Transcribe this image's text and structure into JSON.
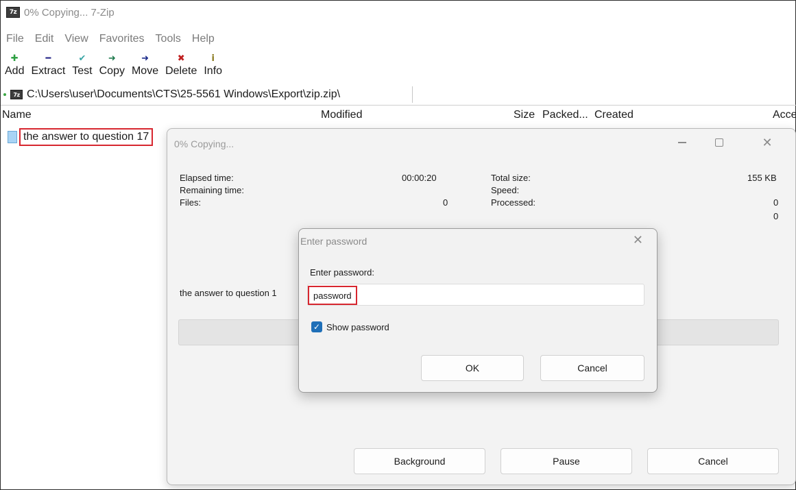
{
  "main_window": {
    "title": "0% Copying... 7-Zip",
    "app_icon_text": "7z"
  },
  "menu": [
    "File",
    "Edit",
    "View",
    "Favorites",
    "Tools",
    "Help"
  ],
  "toolbar": [
    {
      "label": "Add",
      "icon": "plus-icon",
      "glyph": "✚"
    },
    {
      "label": "Extract",
      "icon": "minus-icon",
      "glyph": "━"
    },
    {
      "label": "Test",
      "icon": "check-icon",
      "glyph": "✔"
    },
    {
      "label": "Copy",
      "icon": "arrow-right-icon",
      "glyph": "➜"
    },
    {
      "label": "Move",
      "icon": "arrow-right-icon",
      "glyph": "➜"
    },
    {
      "label": "Delete",
      "icon": "x-icon",
      "glyph": "✖"
    },
    {
      "label": "Info",
      "icon": "info-icon",
      "glyph": "i"
    }
  ],
  "address": {
    "path": "C:\\Users\\user\\Documents\\CTS\\25-5561 Windows\\Export\\zip.zip\\"
  },
  "columns": [
    "Name",
    "Modified",
    "Size",
    "Packed...",
    "Created",
    "Acce"
  ],
  "files": [
    {
      "name": "the answer to question 17"
    }
  ],
  "copy_dialog": {
    "title": "0% Copying...",
    "elapsed_label": "Elapsed time:",
    "elapsed_value": "00:00:20",
    "remaining_label": "Remaining time:",
    "files_label": "Files:",
    "files_value": "0",
    "total_size_label": "Total size:",
    "total_size_value": "155 KB",
    "speed_label": "Speed:",
    "processed_label": "Processed:",
    "processed_value": "0",
    "extra_value": "0",
    "current_file": "the answer to question 1",
    "progress_percent": 0,
    "background_label": "Background",
    "pause_label": "Pause",
    "cancel_label": "Cancel"
  },
  "password_dialog": {
    "title": "Enter password",
    "label": "Enter password:",
    "value": "password",
    "show_password_label": "Show password",
    "show_password_checked": true,
    "ok_label": "OK",
    "cancel_label": "Cancel"
  },
  "colors": {
    "highlight_red": "#d7262f",
    "checkbox_blue": "#1f6fb8",
    "progress_green": "#28a745"
  }
}
